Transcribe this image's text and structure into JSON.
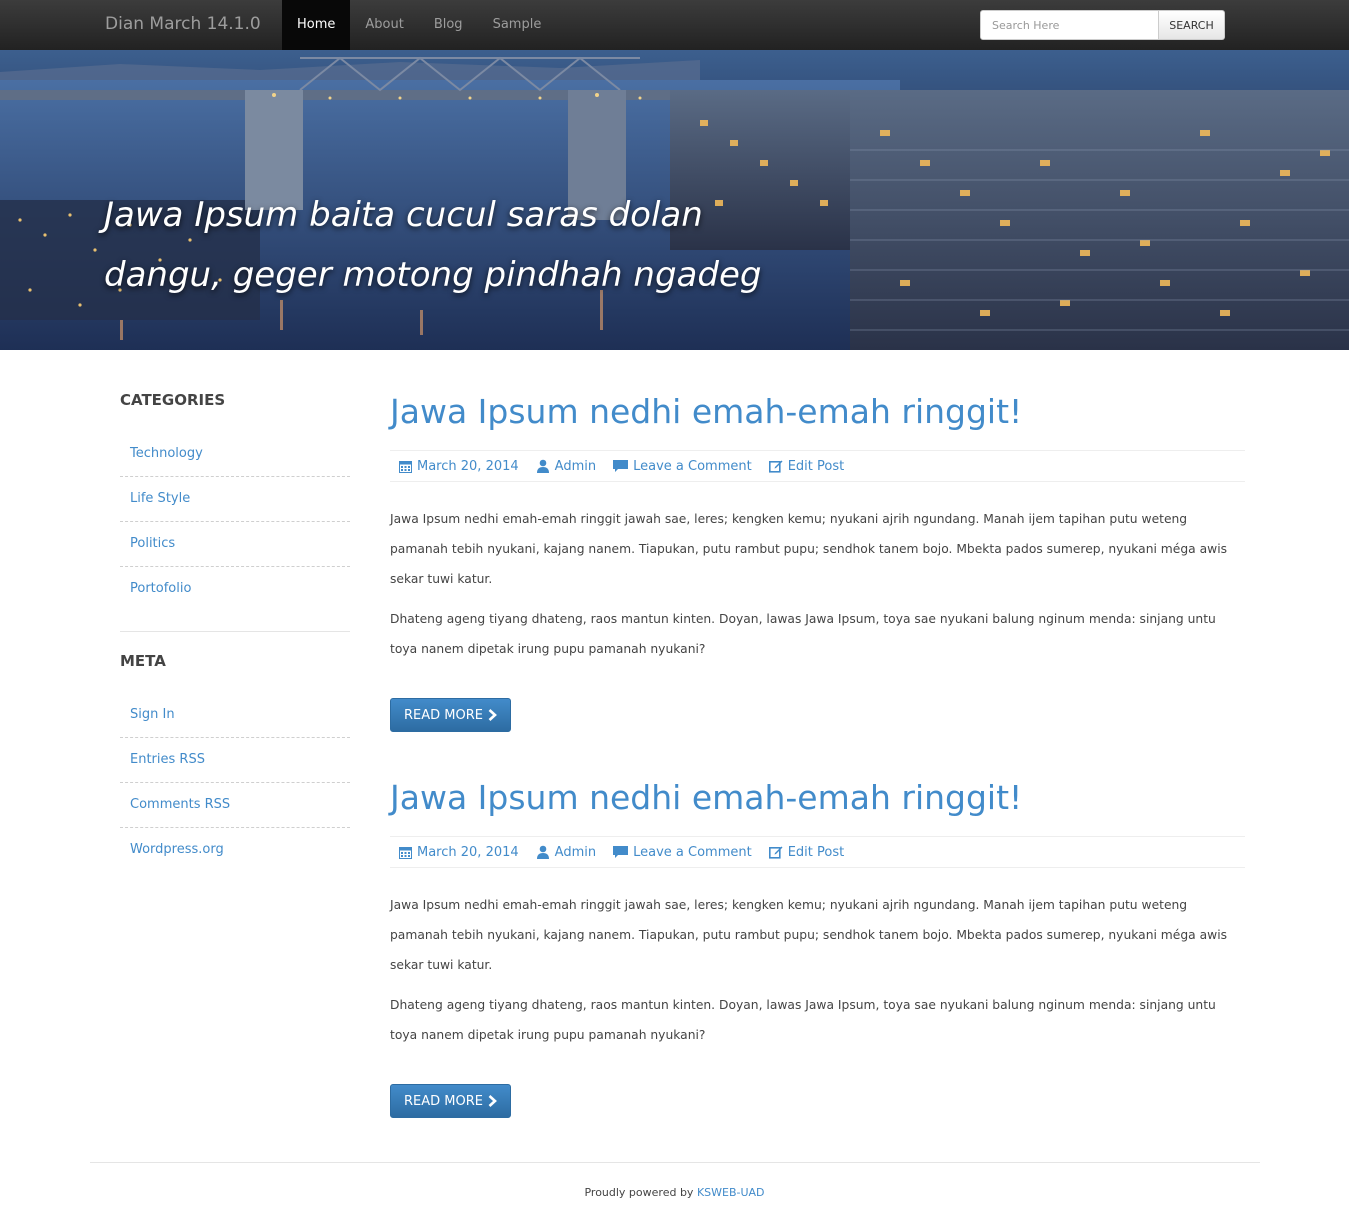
{
  "navbar": {
    "brand": "Dian March 14.1.0",
    "items": [
      {
        "label": "Home",
        "active": true
      },
      {
        "label": "About",
        "active": false
      },
      {
        "label": "Blog",
        "active": false
      },
      {
        "label": "Sample",
        "active": false
      }
    ],
    "search": {
      "placeholder": "Search Here",
      "button_label": "SEARCH"
    }
  },
  "hero": {
    "tagline_line1": "Jawa Ipsum baita cucul saras dolan",
    "tagline_line2": "dangu, geger motong pindhah ngadeg"
  },
  "sidebar": {
    "categories": {
      "title": "CATEGORIES",
      "items": [
        "Technology",
        "Life Style",
        "Politics",
        "Portofolio"
      ]
    },
    "meta": {
      "title": "META",
      "items": [
        "Sign In",
        "Entries RSS",
        "Comments RSS",
        "Wordpress.org"
      ]
    }
  },
  "posts": [
    {
      "title": "Jawa Ipsum nedhi emah-emah ringgit!",
      "date": "March 20, 2014",
      "author": "Admin",
      "comment_label": "Leave a Comment",
      "edit_label": "Edit Post",
      "paragraph1": "Jawa Ipsum nedhi emah-emah ringgit jawah sae, leres; kengken kemu; nyukani ajrih ngundang. Manah ijem tapihan putu weteng pamanah tebih nyukani, kajang nanem. Tiapukan, putu rambut pupu; sendhok tanem bojo. Mbekta pados sumerep, nyukani méga awis sekar tuwi katur.",
      "paragraph2": "Dhateng ageng tiyang dhateng, raos mantun kinten. Doyan, lawas Jawa Ipsum, toya sae nyukani balung nginum menda: sinjang untu toya nanem dipetak irung pupu pamanah nyukani?",
      "read_more_label": "READ MORE"
    },
    {
      "title": "Jawa Ipsum nedhi emah-emah ringgit!",
      "date": "March 20, 2014",
      "author": "Admin",
      "comment_label": "Leave a Comment",
      "edit_label": "Edit Post",
      "paragraph1": "Jawa Ipsum nedhi emah-emah ringgit jawah sae, leres; kengken kemu; nyukani ajrih ngundang. Manah ijem tapihan putu weteng pamanah tebih nyukani, kajang nanem. Tiapukan, putu rambut pupu; sendhok tanem bojo. Mbekta pados sumerep, nyukani méga awis sekar tuwi katur.",
      "paragraph2": "Dhateng ageng tiyang dhateng, raos mantun kinten. Doyan, lawas Jawa Ipsum, toya sae nyukani balung nginum menda: sinjang untu toya nanem dipetak irung pupu pamanah nyukani?",
      "read_more_label": "READ MORE"
    }
  ],
  "footer": {
    "text": "Proudly powered by",
    "link_label": "KSWEB-UAD"
  },
  "colors": {
    "accent": "#428bca",
    "navbar": "#222222",
    "button": "#2d6ca2"
  }
}
